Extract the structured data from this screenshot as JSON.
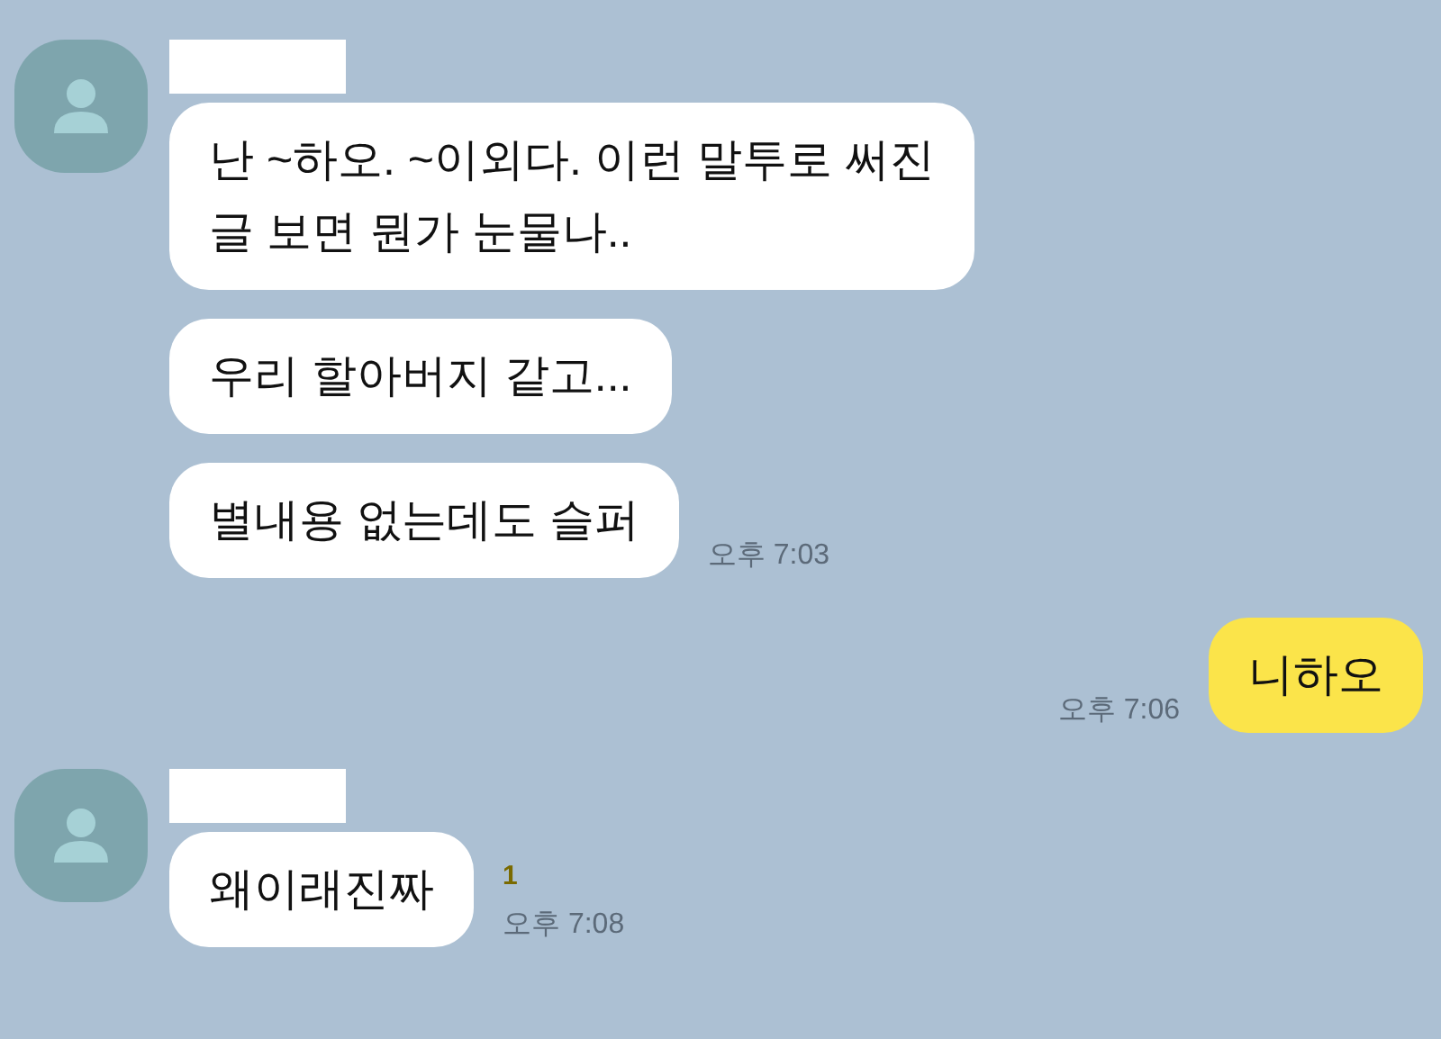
{
  "messages": [
    {
      "kind": "incoming",
      "bubbles": [
        "난 ~하오. ~이외다. 이런 말투로 써진\n글 보면 뭔가 눈물나..",
        "우리 할아버지 같고...",
        "별내용 없는데도 슬퍼"
      ],
      "time": "오후 7:03"
    },
    {
      "kind": "outgoing",
      "bubbles": [
        "니하오"
      ],
      "time": "오후 7:06"
    },
    {
      "kind": "incoming",
      "bubbles": [
        "왜이래진짜"
      ],
      "unread": "1",
      "time": "오후 7:08"
    }
  ]
}
